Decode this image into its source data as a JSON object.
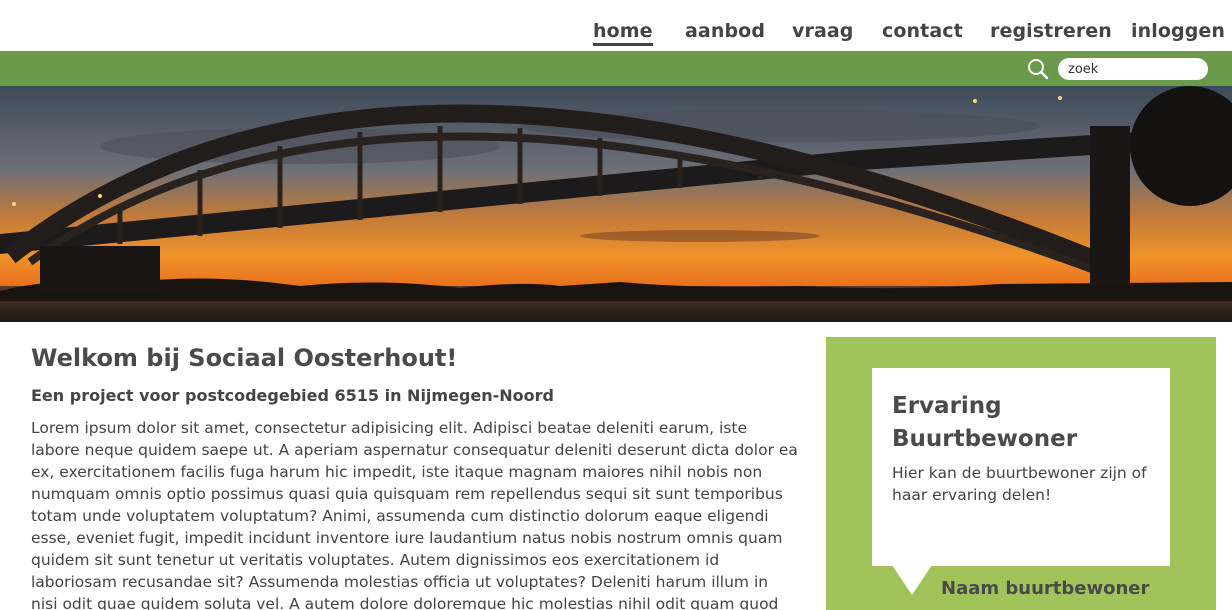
{
  "nav": {
    "items": [
      {
        "label": "home",
        "active": true
      },
      {
        "label": "aanbod",
        "active": false
      },
      {
        "label": "vraag",
        "active": false
      },
      {
        "label": "contact",
        "active": false
      },
      {
        "label": "registreren",
        "active": false
      },
      {
        "label": "inloggen",
        "active": false
      }
    ]
  },
  "search": {
    "value": "zoek",
    "icon": "search-icon"
  },
  "colors": {
    "green_bar": "#6b9a4a",
    "sidebar_green": "#a1c45a",
    "text": "#444444"
  },
  "main": {
    "title": "Welkom bij Sociaal Oosterhout!",
    "subtitle": "Een project voor postcodegebied 6515 in Nijmegen-Noord",
    "body": "Lorem ipsum dolor sit amet, consectetur adipisicing elit. Adipisci beatae deleniti earum, iste labore neque quidem saepe ut. A aperiam aspernatur consequatur deleniti deserunt dicta dolor ea ex, exercitationem facilis fuga harum hic impedit, iste itaque magnam maiores nihil nobis non numquam omnis optio possimus quasi quia quisquam rem repellendus sequi sit sunt temporibus totam unde voluptatem voluptatum? Animi, assumenda cum distinctio dolorum eaque eligendi esse, eveniet fugit, impedit incidunt inventore iure laudantium natus nobis nostrum omnis quam quidem sit sunt tenetur ut veritatis voluptates. Autem dignissimos eos exercitationem id laboriosam recusandae sit? Assumenda molestias officia ut voluptates? Deleniti harum illum in nisi odit quae quidem soluta vel. A autem dolore doloremque hic molestias nihil odit quam quod tempore. Ab accusantium aliquid"
  },
  "sidebar": {
    "title": "Ervaring Buurtbewoner",
    "text": "Hier kan de buurtbewoner zijn of haar ervaring delen!",
    "author": "Naam buurtbewoner"
  }
}
